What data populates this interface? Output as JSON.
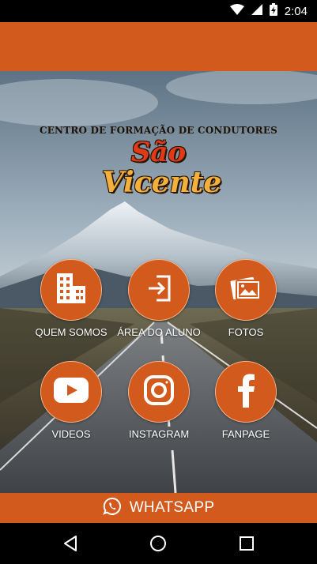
{
  "status_bar": {
    "time": "2:04",
    "icons": [
      "wifi-icon",
      "signal-icon",
      "battery-charging-icon"
    ]
  },
  "logo": {
    "tagline": "CENTRO DE FORMAÇÃO DE CONDUTORES",
    "name_line1": "São",
    "name_line2": "Vicente"
  },
  "menu": [
    {
      "label": "QUEM SOMOS",
      "icon": "building-icon"
    },
    {
      "label": "ÁREA DO ALUNO",
      "icon": "login-icon"
    },
    {
      "label": "FOTOS",
      "icon": "photos-icon"
    },
    {
      "label": "VIDEOS",
      "icon": "youtube-icon"
    },
    {
      "label": "INSTAGRAM",
      "icon": "instagram-icon"
    },
    {
      "label": "FANPAGE",
      "icon": "facebook-icon"
    }
  ],
  "whatsapp": {
    "label": "WHATSAPP",
    "icon": "whatsapp-icon"
  },
  "nav_bar": {
    "icons": [
      "back-icon",
      "home-icon",
      "recents-icon"
    ]
  },
  "colors": {
    "accent": "#d35a1d",
    "status_bar": "#000000"
  }
}
